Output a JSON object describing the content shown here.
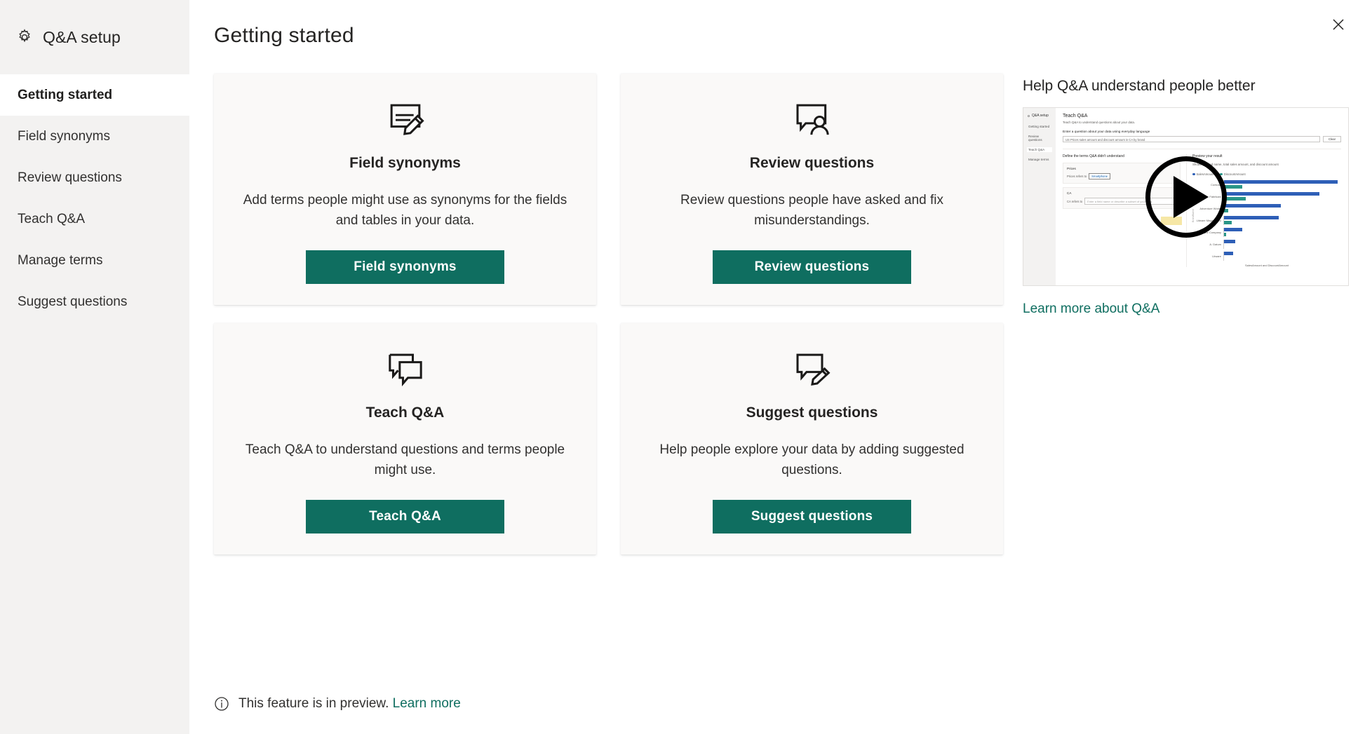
{
  "sidebar": {
    "icon": "gear-icon",
    "title": "Q&A setup",
    "items": [
      {
        "label": "Getting started",
        "active": true
      },
      {
        "label": "Field synonyms",
        "active": false
      },
      {
        "label": "Review questions",
        "active": false
      },
      {
        "label": "Teach Q&A",
        "active": false
      },
      {
        "label": "Manage terms",
        "active": false
      },
      {
        "label": "Suggest questions",
        "active": false
      }
    ]
  },
  "header": {
    "page_title": "Getting started",
    "close_icon": "close-icon"
  },
  "cards": [
    {
      "icon": "note-edit-icon",
      "title": "Field synonyms",
      "description": "Add terms people might use as synonyms for the fields and tables in your data.",
      "button_label": "Field synonyms"
    },
    {
      "icon": "comment-person-icon",
      "title": "Review questions",
      "description": "Review questions people have asked and fix misunderstandings.",
      "button_label": "Review questions"
    },
    {
      "icon": "double-comment-icon",
      "title": "Teach Q&A",
      "description": "Teach Q&A to understand questions and terms people might use.",
      "button_label": "Teach Q&A"
    },
    {
      "icon": "comment-edit-icon",
      "title": "Suggest questions",
      "description": "Help people explore your data by adding suggested questions.",
      "button_label": "Suggest questions"
    }
  ],
  "promo": {
    "title": "Help Q&A understand people better",
    "link_label": "Learn more about Q&A",
    "play_icon": "play-icon",
    "thumbnail": {
      "sidebar_title": "Q&A setup",
      "sidebar_items": [
        "Getting started",
        "Review questions",
        "Teach Q&A",
        "Manage terms"
      ],
      "selected_sidebar_item": "Teach Q&A",
      "heading": "Teach Q&A",
      "subheading": "Teach Q&A to understand questions about your data.",
      "input_label": "Enter a question about your data using everyday language",
      "input_value": "US Prices sales amount and discount amount in CA by brand",
      "clear_button": "Clear",
      "define_title": "Define the terms Q&A didn't understand",
      "term_panels": [
        {
          "term": "Prices",
          "row_label": "Prices refers to",
          "value": "Smartphone"
        },
        {
          "term": "CA",
          "row_label": "CA refers to",
          "value": "Enter a field name or describe a subset of your data"
        }
      ],
      "result_title": "Preview your result",
      "result_subtitle": "Showing brand name, total sales amount, and discount amount",
      "legend": [
        {
          "name": "SalesAmount",
          "color": "#2e5fb7"
        },
        {
          "name": "DiscountAmount",
          "color": "#2a9688"
        }
      ],
      "chart_xlabel": "SalesAmount and DiscountAmount",
      "chart_ylabel": "BrandName"
    }
  },
  "chart_data": {
    "type": "bar",
    "title": "Preview your result",
    "subtitle": "Showing brand name, total sales amount, and discount amount",
    "categories": [
      "Contoso",
      "Fabrikam",
      "Adventure Works",
      "Litware Mega Video",
      "The Phone Company",
      "A. Datum",
      "Litware"
    ],
    "series": [
      {
        "name": "SalesAmount",
        "color": "#2e5fb7",
        "values": [
          100,
          84,
          50,
          48,
          16,
          10,
          8
        ]
      },
      {
        "name": "DiscountAmount",
        "color": "#2a9688",
        "values": [
          16,
          19,
          4,
          7,
          2,
          0,
          0
        ]
      }
    ],
    "xlabel": "SalesAmount and DiscountAmount",
    "ylabel": "BrandName",
    "orientation": "horizontal",
    "legend_position": "top",
    "grid": false
  },
  "footer": {
    "icon": "info-icon",
    "text": "This feature is in preview.",
    "link_label": "Learn more"
  },
  "colors": {
    "accent": "#0f6e60",
    "sidebar_bg": "#f3f2f1",
    "card_bg": "#faf9f8",
    "text": "#252423"
  }
}
